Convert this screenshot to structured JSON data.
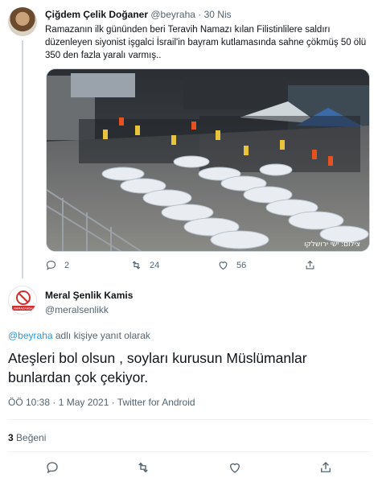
{
  "parent_tweet": {
    "name": "Çiğdem Çelik Doğaner",
    "handle": "@beyraha",
    "separator": "·",
    "time": "30 Nis",
    "text": "Ramazanın ilk gününden beri Teravih Namazı kılan Filistinlilere saldırı düzenleyen siyonist işgalci İsrail'in bayram kutlamasında sahne çökmüş 50 ölü 350 den fazla yaralı varmış..",
    "image_watermark": "צילום: ישי ירושלקו",
    "actions": {
      "reply_icon": "reply-icon",
      "reply_count": "2",
      "retweet_icon": "retweet-icon",
      "retweet_count": "24",
      "like_icon": "heart-icon",
      "like_count": "56",
      "share_icon": "share-icon"
    }
  },
  "reply_tweet": {
    "name": "Meral Şenlik Kamis",
    "handle": "@meralsenlikk",
    "avatar_text": "RAMAZANDA",
    "replying_mention": "@beyraha",
    "replying_suffix": " adlı kişiye yanıt olarak",
    "text": "Ateşleri bol olsun , soyları kurusun Müslümanlar bunlardan çok çekiyor.",
    "timestamp": "ÖÖ 10:38 · 1 May 2021 · Twitter for Android",
    "likes_count": "3",
    "likes_label": "Beğeni"
  },
  "colors": {
    "text": "#0f1419",
    "secondary": "#536471",
    "link": "#1d9bf0",
    "divider": "#eff3f4",
    "thread_line": "#cfd9de"
  }
}
